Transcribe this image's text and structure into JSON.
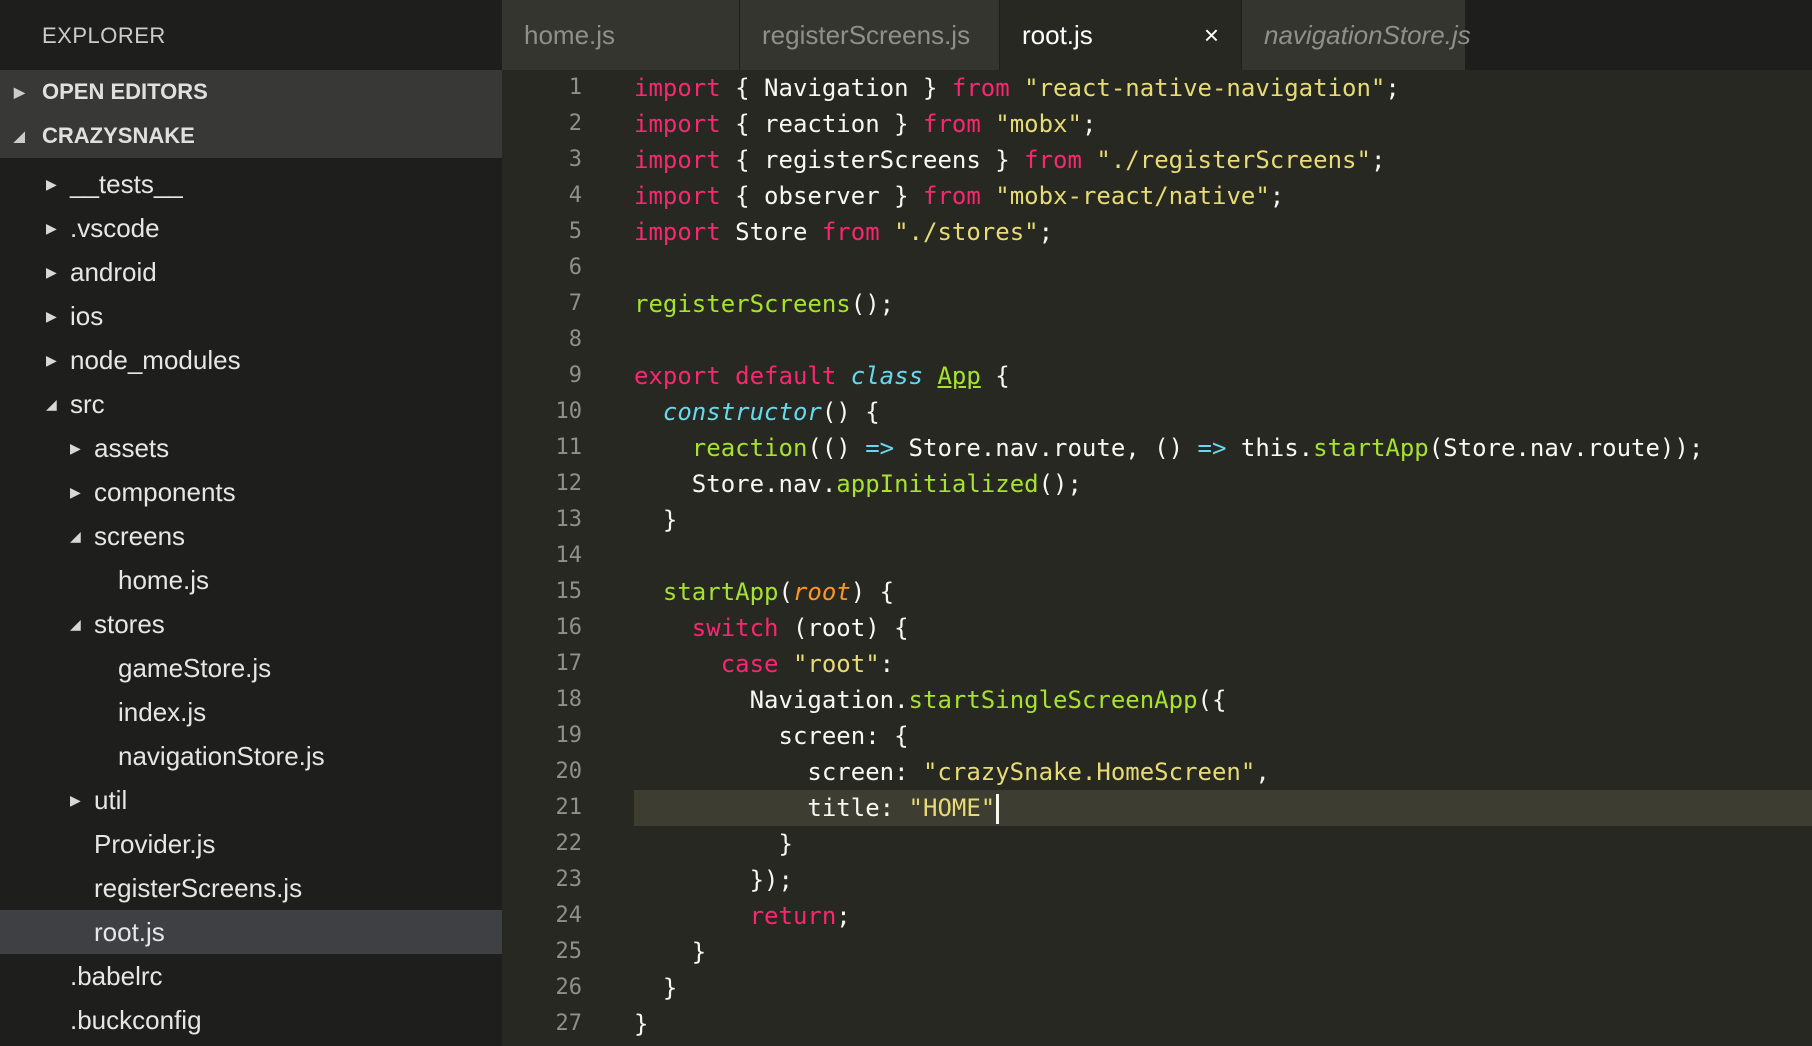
{
  "colors": {
    "keyword": "#f92672",
    "string": "#e6db74",
    "function": "#a6e22e",
    "storage": "#66d9ef",
    "param": "#fd971f",
    "text": "#f8f8f2",
    "class_name": "#a6e22e"
  },
  "sidebar": {
    "title": "EXPLORER",
    "sections": [
      {
        "label": "OPEN EDITORS",
        "expanded": false
      },
      {
        "label": "CRAZYSNAKE",
        "expanded": true
      }
    ],
    "tree": [
      {
        "label": "__tests__",
        "depth": 1,
        "folder": true,
        "expanded": false
      },
      {
        "label": ".vscode",
        "depth": 1,
        "folder": true,
        "expanded": false
      },
      {
        "label": "android",
        "depth": 1,
        "folder": true,
        "expanded": false
      },
      {
        "label": "ios",
        "depth": 1,
        "folder": true,
        "expanded": false
      },
      {
        "label": "node_modules",
        "depth": 1,
        "folder": true,
        "expanded": false
      },
      {
        "label": "src",
        "depth": 1,
        "folder": true,
        "expanded": true
      },
      {
        "label": "assets",
        "depth": 2,
        "folder": true,
        "expanded": false
      },
      {
        "label": "components",
        "depth": 2,
        "folder": true,
        "expanded": false
      },
      {
        "label": "screens",
        "depth": 2,
        "folder": true,
        "expanded": true
      },
      {
        "label": "home.js",
        "depth": 3,
        "folder": false
      },
      {
        "label": "stores",
        "depth": 2,
        "folder": true,
        "expanded": true
      },
      {
        "label": "gameStore.js",
        "depth": 3,
        "folder": false
      },
      {
        "label": "index.js",
        "depth": 3,
        "folder": false
      },
      {
        "label": "navigationStore.js",
        "depth": 3,
        "folder": false
      },
      {
        "label": "util",
        "depth": 2,
        "folder": true,
        "expanded": false
      },
      {
        "label": "Provider.js",
        "depth": 2,
        "folder": false
      },
      {
        "label": "registerScreens.js",
        "depth": 2,
        "folder": false
      },
      {
        "label": "root.js",
        "depth": 2,
        "folder": false,
        "selected": true
      },
      {
        "label": ".babelrc",
        "depth": 1,
        "folder": false
      },
      {
        "label": ".buckconfig",
        "depth": 1,
        "folder": false
      }
    ]
  },
  "tabs": [
    {
      "label": "home.js"
    },
    {
      "label": "registerScreens.js"
    },
    {
      "label": "root.js",
      "active": true,
      "close": "×"
    },
    {
      "label": "navigationStore.js",
      "preview": true
    }
  ],
  "editor": {
    "current_line": 21,
    "lines": [
      [
        [
          "keyword",
          "import"
        ],
        [
          "text",
          " { Navigation } "
        ],
        [
          "keyword",
          "from"
        ],
        [
          "text",
          " "
        ],
        [
          "string",
          "\"react-native-navigation\""
        ],
        [
          "text",
          ";"
        ]
      ],
      [
        [
          "keyword",
          "import"
        ],
        [
          "text",
          " { reaction } "
        ],
        [
          "keyword",
          "from"
        ],
        [
          "text",
          " "
        ],
        [
          "string",
          "\"mobx\""
        ],
        [
          "text",
          ";"
        ]
      ],
      [
        [
          "keyword",
          "import"
        ],
        [
          "text",
          " { registerScreens } "
        ],
        [
          "keyword",
          "from"
        ],
        [
          "text",
          " "
        ],
        [
          "string",
          "\"./registerScreens\""
        ],
        [
          "text",
          ";"
        ]
      ],
      [
        [
          "keyword",
          "import"
        ],
        [
          "text",
          " { observer } "
        ],
        [
          "keyword",
          "from"
        ],
        [
          "text",
          " "
        ],
        [
          "string",
          "\"mobx-react/native\""
        ],
        [
          "text",
          ";"
        ]
      ],
      [
        [
          "keyword",
          "import"
        ],
        [
          "text",
          " Store "
        ],
        [
          "keyword",
          "from"
        ],
        [
          "text",
          " "
        ],
        [
          "string",
          "\"./stores\""
        ],
        [
          "text",
          ";"
        ]
      ],
      [],
      [
        [
          "function",
          "registerScreens"
        ],
        [
          "text",
          "();"
        ]
      ],
      [],
      [
        [
          "keyword",
          "export"
        ],
        [
          "text",
          " "
        ],
        [
          "keyword",
          "default"
        ],
        [
          "text",
          " "
        ],
        [
          "storage",
          "class"
        ],
        [
          "text",
          " "
        ],
        [
          "class_name",
          "App"
        ],
        [
          "text",
          " {"
        ]
      ],
      [
        [
          "text",
          "  "
        ],
        [
          "storage",
          "constructor"
        ],
        [
          "text",
          "() {"
        ]
      ],
      [
        [
          "text",
          "    "
        ],
        [
          "function",
          "reaction"
        ],
        [
          "text",
          "(() "
        ],
        [
          "storage",
          "=>"
        ],
        [
          "text",
          " Store.nav.route, () "
        ],
        [
          "storage",
          "=>"
        ],
        [
          "text",
          " this."
        ],
        [
          "function",
          "startApp"
        ],
        [
          "text",
          "(Store.nav.route));"
        ]
      ],
      [
        [
          "text",
          "    Store.nav."
        ],
        [
          "function",
          "appInitialized"
        ],
        [
          "text",
          "();"
        ]
      ],
      [
        [
          "text",
          "  }"
        ]
      ],
      [],
      [
        [
          "text",
          "  "
        ],
        [
          "function",
          "startApp"
        ],
        [
          "text",
          "("
        ],
        [
          "param",
          "root"
        ],
        [
          "text",
          ") {"
        ]
      ],
      [
        [
          "text",
          "    "
        ],
        [
          "keyword",
          "switch"
        ],
        [
          "text",
          " (root) {"
        ]
      ],
      [
        [
          "text",
          "      "
        ],
        [
          "keyword",
          "case"
        ],
        [
          "text",
          " "
        ],
        [
          "string",
          "\"root\""
        ],
        [
          "text",
          ":"
        ]
      ],
      [
        [
          "text",
          "        Navigation."
        ],
        [
          "function",
          "startSingleScreenApp"
        ],
        [
          "text",
          "({"
        ]
      ],
      [
        [
          "text",
          "          screen: {"
        ]
      ],
      [
        [
          "text",
          "            screen: "
        ],
        [
          "string",
          "\"crazySnake.HomeScreen\""
        ],
        [
          "text",
          ","
        ]
      ],
      [
        [
          "text",
          "            title: "
        ],
        [
          "string",
          "\"HOME\""
        ]
      ],
      [
        [
          "text",
          "          }"
        ]
      ],
      [
        [
          "text",
          "        });"
        ]
      ],
      [
        [
          "text",
          "        "
        ],
        [
          "keyword",
          "return"
        ],
        [
          "text",
          ";"
        ]
      ],
      [
        [
          "text",
          "    }"
        ]
      ],
      [
        [
          "text",
          "  }"
        ]
      ],
      [
        [
          "text",
          "}"
        ]
      ]
    ]
  }
}
